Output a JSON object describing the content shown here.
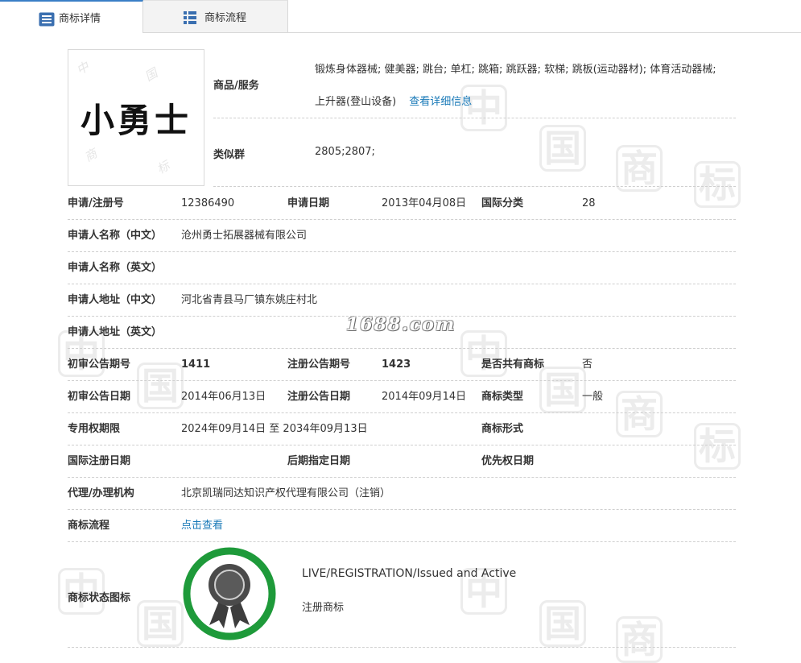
{
  "tabs": [
    {
      "label": "商标详情",
      "icon": "list-icon",
      "active": true
    },
    {
      "label": "商标流程",
      "icon": "grid-icon",
      "active": false
    }
  ],
  "watermark": {
    "site": "1688.com",
    "chars": [
      "中",
      "国",
      "商",
      "标"
    ]
  },
  "logo": {
    "text": "小勇士"
  },
  "goods": {
    "label": "商品/服务",
    "line1": "锻炼身体器械; 健美器; 跳台; 单杠; 跳箱; 跳跃器; 软梯; 跳板(运动器材); 体育活动器械;",
    "line2": "上升器(登山设备)",
    "detail_link": "查看详细信息"
  },
  "similar": {
    "label": "类似群",
    "value": "2805;2807;"
  },
  "rows": {
    "reg_no": {
      "label": "申请/注册号",
      "value": "12386490"
    },
    "apply_date": {
      "label": "申请日期",
      "value": "2013年04月08日"
    },
    "intl_class": {
      "label": "国际分类",
      "value": "28"
    },
    "applicant_cn": {
      "label": "申请人名称（中文）",
      "value": "沧州勇士拓展器械有限公司"
    },
    "applicant_en": {
      "label": "申请人名称（英文）",
      "value": ""
    },
    "address_cn": {
      "label": "申请人地址（中文）",
      "value": "河北省青县马厂镇东姚庄村北"
    },
    "address_en": {
      "label": "申请人地址（英文）",
      "value": ""
    },
    "prelim_no": {
      "label": "初审公告期号",
      "value": "1411"
    },
    "reg_pub_no": {
      "label": "注册公告期号",
      "value": "1423"
    },
    "shared": {
      "label": "是否共有商标",
      "value": "否"
    },
    "prelim_date": {
      "label": "初审公告日期",
      "value": "2014年06月13日"
    },
    "reg_pub_date": {
      "label": "注册公告日期",
      "value": "2014年09月14日"
    },
    "tm_type": {
      "label": "商标类型",
      "value": "一般"
    },
    "exclusive": {
      "label": "专用权期限",
      "value": "2024年09月14日 至 2034年09月13日"
    },
    "tm_form": {
      "label": "商标形式",
      "value": ""
    },
    "intl_reg_date": {
      "label": "国际注册日期",
      "value": ""
    },
    "later_date": {
      "label": "后期指定日期",
      "value": ""
    },
    "priority_date": {
      "label": "优先权日期",
      "value": ""
    },
    "agent": {
      "label": "代理/办理机构",
      "value": "北京凯瑞同达知识产权代理有限公司（注销）"
    },
    "flow": {
      "label": "商标流程",
      "value": "点击查看"
    }
  },
  "status": {
    "label": "商标状态图标",
    "line1": "LIVE/REGISTRATION/Issued and Active",
    "line2": "注册商标",
    "ring_color": "#1e9a3a",
    "icon": "award-rosette-icon"
  }
}
